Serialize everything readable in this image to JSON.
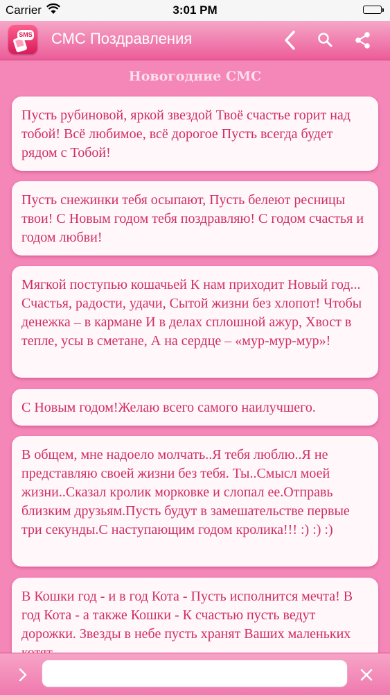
{
  "status_bar": {
    "carrier": "Carrier",
    "time": "3:01 PM"
  },
  "nav": {
    "app_icon_text": "SMS",
    "title": "СМС Поздравления",
    "icons": [
      "back-icon",
      "search-icon",
      "share-icon"
    ]
  },
  "section_title": "Новогодние СМС",
  "messages": [
    "Пусть рубиновой, яркой звездой Твоё счастье горит над тобой! Всё любимое, всё дорогое Пусть всегда будет рядом с Тобой!",
    "Пусть снежинки тебя осыпают, Пусть белеют ресницы твои! С Новым годом тебя поздравляю! С годом счастья и годом любви!",
    "Мягкой поступью кошачьей К нам приходит Новый год... Счастья, радости, удачи, Сытой жизни без хлопот! Чтобы денежка – в кармане И в делах сплошной ажур, Хвост в тепле, усы в сметане, А на сердце – «мур-мур-мур»!",
    "С Новым годом!Желаю всего самого наилучшего.",
    "В общем, мне надоело молчать..Я тебя люблю..Я не представляю своей жизни без тебя. Ты..Смысл моей жизни..Сказал кролик морковке и слопал ее.Отправь близким друзьям.Пусть будут в замешательстве первые три секунды.С наступающим годом кролика!!! :) :) :)",
    "В Кошки год - и в год Кота - Пусть исполнится мечта! В год Кота - а также Кошки - К счастью пусть ведут дорожки. Звезды в небе пусть хранят Ваших маленьких котят"
  ],
  "bottom_bar": {
    "input_value": "",
    "icons": [
      "chevron-right-icon",
      "close-icon"
    ]
  },
  "colors": {
    "accent": "#ec5c98",
    "background": "#f486b8",
    "message_text": "#cf2f62",
    "card": "#fff7fa"
  }
}
